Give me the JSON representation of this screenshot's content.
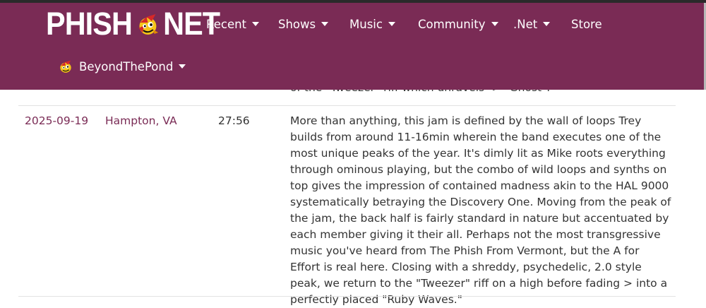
{
  "colors": {
    "brand": "#7a2b55",
    "text": "#333333",
    "link": "#7a2b55"
  },
  "header": {
    "logo_left": "PHISH",
    "logo_right": "NET",
    "logo_icon": "mascot-icon",
    "nav": [
      {
        "label": "Recent",
        "has_dropdown": true
      },
      {
        "label": "Shows",
        "has_dropdown": true
      },
      {
        "label": "Music",
        "has_dropdown": true
      },
      {
        "label": "Community",
        "has_dropdown": true
      },
      {
        "label": ".Net",
        "has_dropdown": true
      },
      {
        "label": "Store",
        "has_dropdown": false
      }
    ],
    "user": {
      "name": "BeyondThePond",
      "icon": "user-mascot-icon",
      "has_dropdown": true
    }
  },
  "previous_row": {
    "notes_tail": "of the \"Tweezer\" riff which unravels -> \"Ghost\"."
  },
  "row": {
    "date": "2025-09-19",
    "venue": "Hampton, VA",
    "duration": "27:56",
    "notes": "More than anything, this jam is defined by the wall of loops Trey builds from around 11-16min wherein the band executes one of the most unique peaks of the year. It's dimly lit as Mike roots everything through ominous playing, but the combo of wild loops and synths on top gives the impression of contained madness akin to the HAL 9000 systematically betraying the Discovery One. Moving from the peak of the jam, the back half is fairly standard in nature but accentuated by each member giving it their all. Perhaps not the most transgressive music you've heard from The Phish From Vermont, but the A for Effort is real here. Closing with a shreddy, psychedelic, 2.0 style peak, we return to the \"Tweezer\" riff on a high before fading > into a perfectly placed \"Ruby Waves.\""
  }
}
